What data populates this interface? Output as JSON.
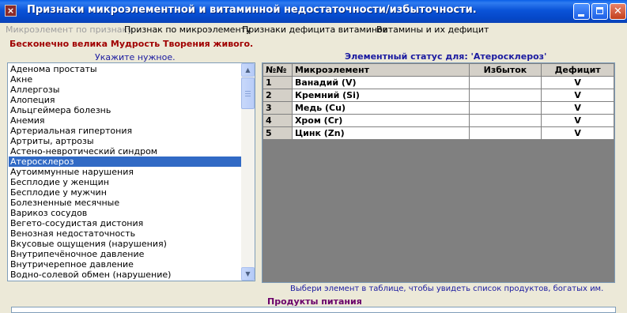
{
  "window": {
    "title": "Признаки микроэлементной и витаминной недостаточности/избыточности.",
    "icon": "app-icon"
  },
  "menu": [
    {
      "label": "Микроэлемент по признаку",
      "enabled": false
    },
    {
      "label": "Признак по микроэлементу",
      "enabled": true
    },
    {
      "label": "Признаки дефицита витаминов",
      "enabled": true
    },
    {
      "label": "Витамины и их дефицит",
      "enabled": true
    }
  ],
  "motto": "Бесконечно велика Мудрость Творения живого.",
  "list_hint": "Укажите нужное.",
  "conditions": {
    "items": [
      "Аденома  простаты",
      "Акне",
      "Аллергозы",
      "Алопеция",
      "Альцгеймера болезнь",
      "Анемия",
      "Артериальная гипертония",
      "Артриты, артрозы",
      "Астено-невротический синдром",
      "Атеросклероз",
      "Аутоиммунные нарушения",
      "Бесплодие у женщин",
      "Бесплодие у мужчин",
      "Болезненные месячные",
      "Варикоз сосудов",
      "Вегето-сосудистая дистония",
      "Венозная недостаточность",
      "Вкусовые ощущения (нарушения)",
      "Внутрипечёночное давление",
      "Внутричерепное давление",
      "Водно-солевой обмен (нарушение)"
    ],
    "selected_index": 9
  },
  "status": {
    "title": "Элементный статус для: 'Атеросклероз'",
    "columns": [
      "№№",
      "Микроэлемент",
      "Избыток",
      "Дефицит"
    ],
    "rows": [
      {
        "n": "1",
        "element": "Ванадий (V)",
        "excess": "",
        "deficit": "V"
      },
      {
        "n": "2",
        "element": "Кремний (Si)",
        "excess": "",
        "deficit": "V"
      },
      {
        "n": "3",
        "element": "Медь (Cu)",
        "excess": "",
        "deficit": "V"
      },
      {
        "n": "4",
        "element": "Хром (Cr)",
        "excess": "",
        "deficit": "V"
      },
      {
        "n": "5",
        "element": "Цинк (Zn)",
        "excess": "",
        "deficit": "V"
      }
    ]
  },
  "table_hint": "Выбери элемент в таблице, чтобы увидеть список продуктов, богатых им.",
  "products_title": "Продукты питания",
  "colors": {
    "titlebar": "#0a53d8",
    "motto": "#a00000",
    "hint": "#1a1aa0",
    "products_title": "#6a006a",
    "selection": "#316ac5",
    "grid_background": "#808080"
  }
}
